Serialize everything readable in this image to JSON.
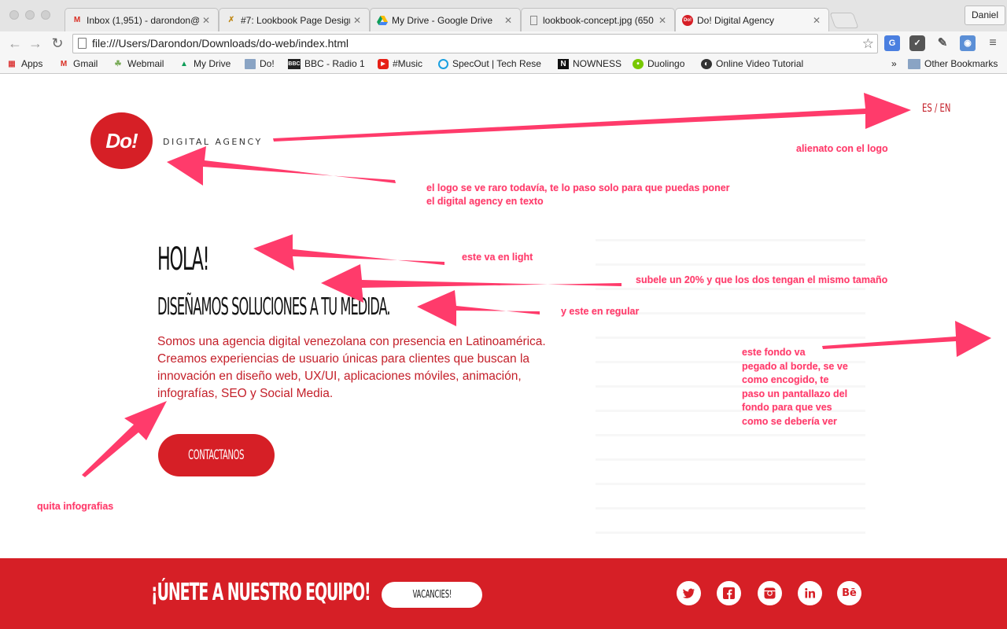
{
  "browser": {
    "tabs": [
      {
        "title": "Inbox (1,951) - darondon@",
        "icon": "gmail-icon",
        "active": false
      },
      {
        "title": "#7: Lookbook Page Design",
        "icon": "lookbook-tab-icon",
        "active": false
      },
      {
        "title": "My Drive - Google Drive",
        "icon": "google-drive-icon",
        "active": false
      },
      {
        "title": "lookbook-concept.jpg (650",
        "icon": "document-icon",
        "active": false
      },
      {
        "title": "Do! Digital Agency",
        "icon": "do-favicon-icon",
        "active": true
      }
    ],
    "profile": "Daniel",
    "address": "file:///Users/Darondon/Downloads/do-web/index.html",
    "bookmarks": [
      {
        "label": "Apps",
        "icon": "apps-grid-icon"
      },
      {
        "label": "Gmail",
        "icon": "gmail-icon"
      },
      {
        "label": "Webmail",
        "icon": "webmail-icon"
      },
      {
        "label": "My Drive",
        "icon": "google-drive-icon"
      },
      {
        "label": "Do!",
        "icon": "folder-icon"
      },
      {
        "label": "BBC - Radio 1",
        "icon": "bbc-icon"
      },
      {
        "label": "#Music",
        "icon": "youtube-icon"
      },
      {
        "label": "SpecOut | Tech Rese",
        "icon": "specout-icon"
      },
      {
        "label": "NOWNESS",
        "icon": "nowness-icon"
      },
      {
        "label": "Duolingo",
        "icon": "duolingo-icon"
      },
      {
        "label": "Online Video Tutorial",
        "icon": "video-tutorial-icon"
      }
    ],
    "overflow_chevron": "»",
    "other_bookmarks": "Other Bookmarks"
  },
  "site": {
    "logo_mark": "Do!",
    "logo_text": "DIGITAL AGENCY",
    "lang": "ES / EN",
    "headline": "HOLA!",
    "subheadline": "DISEÑAMOS SOLUCIONES A TU MEDIDA.",
    "body_lines": [
      "Somos una agencia digital venezolana con presencia en Latinoamérica.",
      "Creamos experiencias de usuario únicas para clientes que buscan la",
      "innovación en diseño web, UX/UI, aplicaciones móviles, animación,",
      "infografías, SEO y Social Media."
    ],
    "cta": "CONTACTANOS",
    "footer": {
      "join": "¡ÚNETE A NUESTRO EQUIPO!",
      "vacancies": "VACANCIES!",
      "social_icons": [
        "twitter-icon",
        "facebook-icon",
        "instagram-icon",
        "linkedin-icon",
        "behance-icon"
      ]
    },
    "brand_color": "#d61f26"
  },
  "annotations": {
    "logo_align": "alienato con el logo",
    "logo_note_1": "el logo se ve raro todavía, te lo paso solo para que puedas poner",
    "logo_note_2": "el digital agency en texto",
    "light": "este va en light",
    "size": "subele un 20% y que los dos tengan el mismo tamaño",
    "regular": "y este en regular",
    "bg_lines": [
      "este fondo va",
      "pegado al borde, se ve",
      "como encogido, te",
      "paso un pantallazo del",
      "fondo para que ves",
      "como se debería ver"
    ],
    "infografias": "quita infografias",
    "color": "#ff3b6b"
  }
}
